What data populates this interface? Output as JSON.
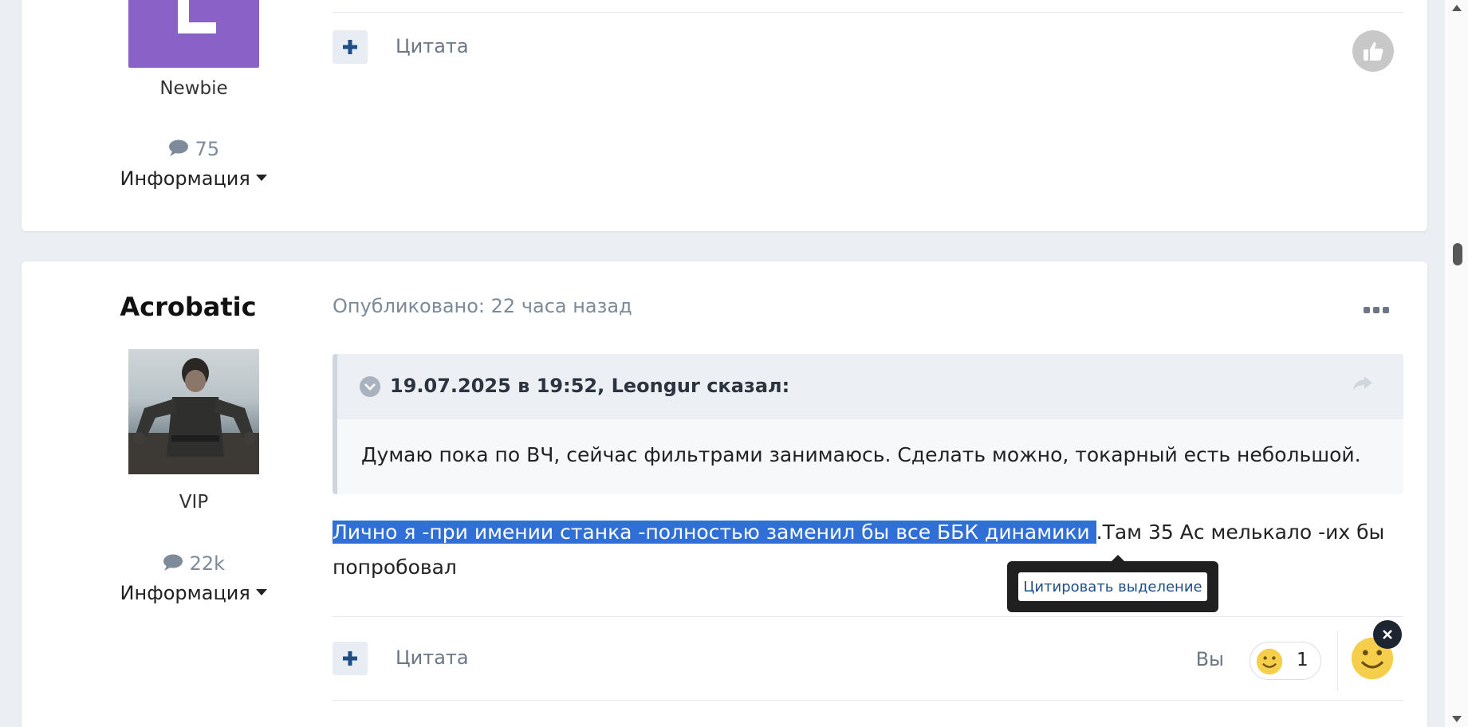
{
  "post1": {
    "rank": "Newbie",
    "post_count": "75",
    "info_label": "Информация",
    "quote_label": "Цитата"
  },
  "post2": {
    "author": "Acrobatic",
    "rank": "VIP",
    "post_count": "22k",
    "info_label": "Информация",
    "posted": "Опубликовано: 22 часа назад",
    "quote": {
      "cite": "19.07.2025 в 19:52, Leongur сказал:",
      "text": "Думаю пока по ВЧ, сейчас фильтрами занимаюсь. Сделать можно, токарный есть небольшой."
    },
    "body_selected": "Лично я -при имении станка -полностью заменил бы все ББК динамики ",
    "body_rest": ".Там 35 Ас мелькало -их бы попробовал",
    "selection_tooltip": "Цитировать выделение",
    "quote_label": "Цитата",
    "reaction_user": "Вы",
    "reaction_count": "1"
  },
  "colors": {
    "accent": "#1f4e86",
    "selection": "#2f6fd6",
    "avatar_bg": "#8961c7"
  }
}
